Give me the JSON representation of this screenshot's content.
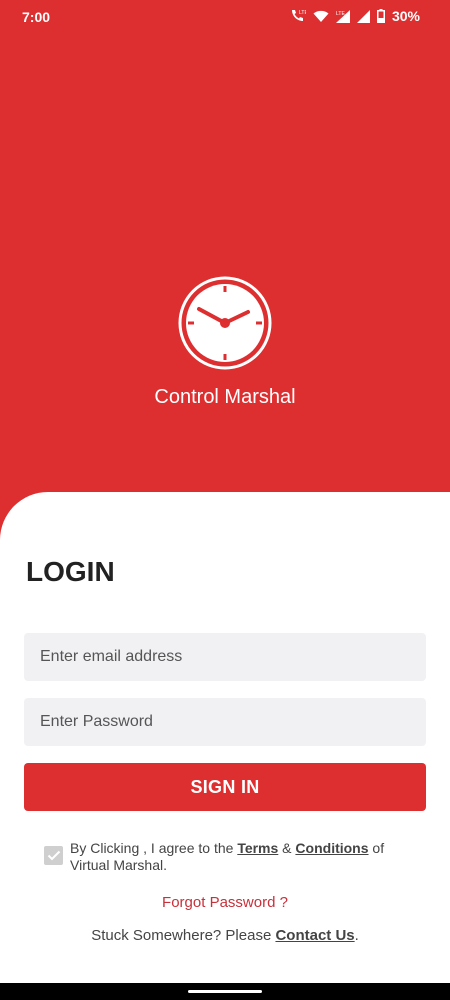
{
  "status_bar": {
    "time": "7:00",
    "battery": "30%",
    "icons": [
      "lte-call-icon",
      "wifi-icon",
      "signal-icon",
      "signal-icon",
      "battery-icon"
    ]
  },
  "app": {
    "name": "Control Marshal",
    "logo_icon": "clock-icon"
  },
  "login": {
    "title": "LOGIN",
    "email_placeholder": "Enter email address",
    "email_value": "",
    "password_placeholder": "Enter Password",
    "password_value": "",
    "signin_label": "SIGN IN",
    "terms": {
      "checked": true,
      "prefix": "By Clicking , I agree to the ",
      "terms_link": "Terms",
      "amp": " & ",
      "conditions_link": "Conditions",
      "suffix": " of Virtual Marshal."
    },
    "forgot_label": "Forgot Password ?",
    "contact_prefix": "Stuck Somewhere? Please ",
    "contact_link": " Contact Us",
    "contact_suffix": "."
  },
  "colors": {
    "brand_red": "#dd2e30",
    "link_red": "#c8303a",
    "field_bg": "#f1f1f3"
  }
}
